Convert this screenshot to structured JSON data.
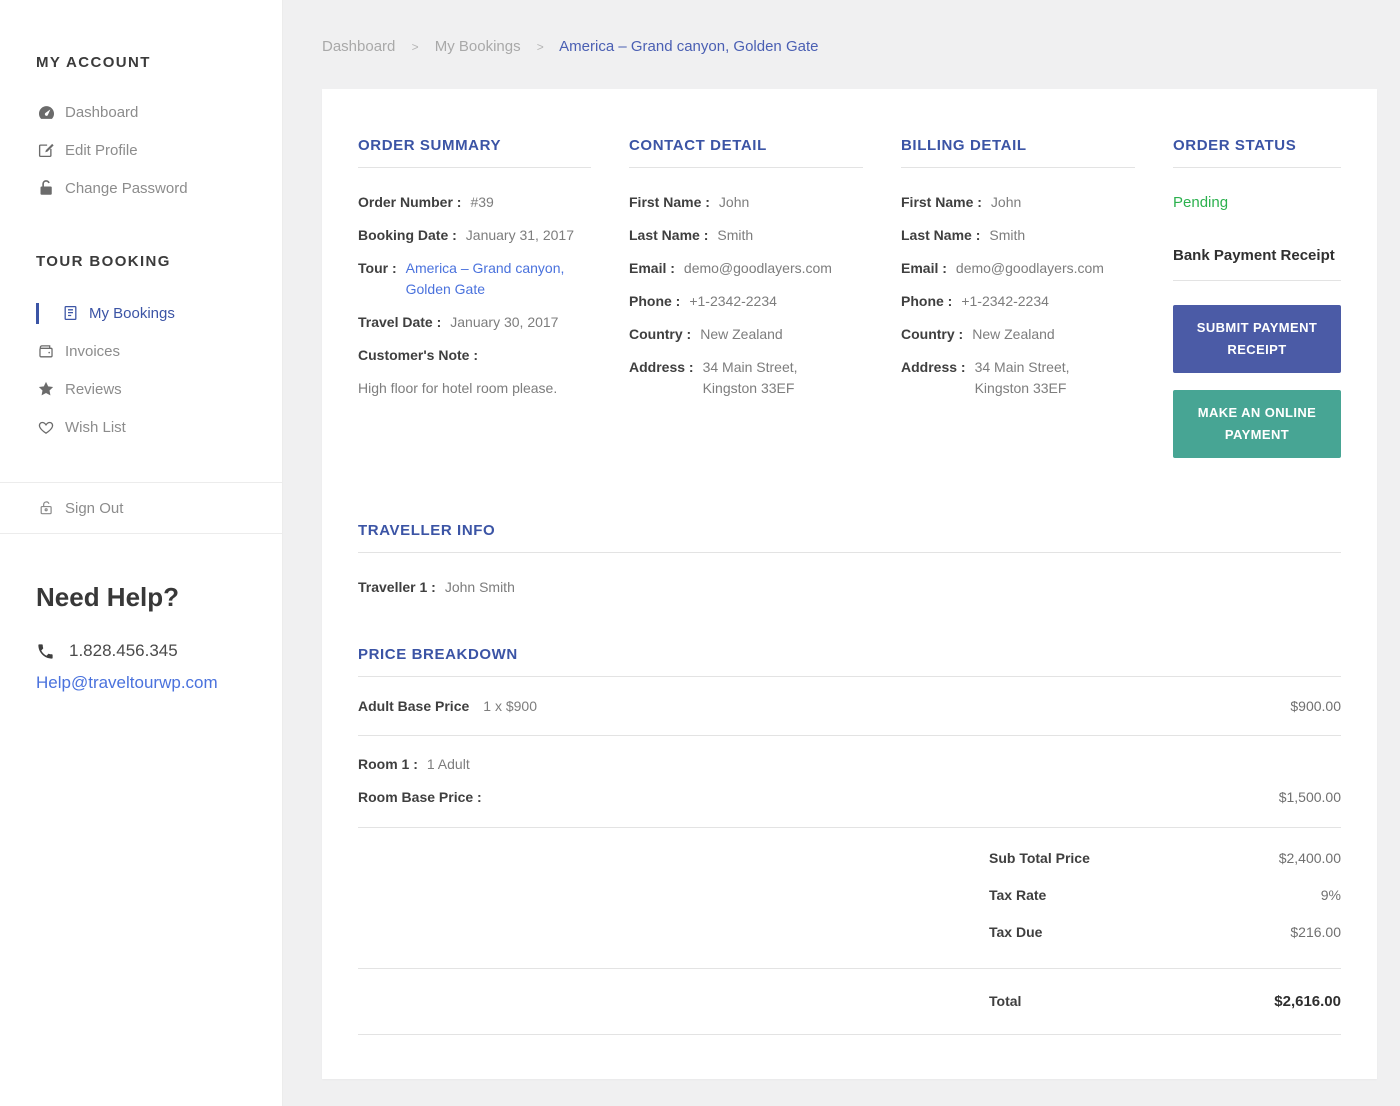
{
  "colors": {
    "accent": "#3b54a5",
    "link_blue": "#4a72dd",
    "status_green": "#2cb14e",
    "button_indigo": "#4b5ba6",
    "button_teal": "#47a594",
    "page_bg": "#f0f0f1"
  },
  "breadcrumb": {
    "home": "Dashboard",
    "section": "My Bookings",
    "current": "America – Grand canyon, Golden Gate",
    "separator": ">"
  },
  "sidebar": {
    "account_title": "MY ACCOUNT",
    "account_items": [
      {
        "label": "Dashboard",
        "icon": "dashboard-icon"
      },
      {
        "label": "Edit Profile",
        "icon": "edit-icon"
      },
      {
        "label": "Change Password",
        "icon": "lock-icon"
      }
    ],
    "booking_title": "TOUR BOOKING",
    "booking_items": [
      {
        "label": "My Bookings",
        "icon": "document-icon",
        "active": true
      },
      {
        "label": "Invoices",
        "icon": "wallet-icon"
      },
      {
        "label": "Reviews",
        "icon": "star-icon"
      },
      {
        "label": "Wish List",
        "icon": "heart-icon"
      }
    ],
    "sign_out": {
      "label": "Sign Out",
      "icon": "unlock-icon"
    },
    "help_title": "Need Help?",
    "help_phone": "1.828.456.345",
    "help_email": "Help@traveltourwp.com"
  },
  "order_summary": {
    "title": "ORDER SUMMARY",
    "order_number_label": "Order Number :",
    "order_number": "#39",
    "booking_date_label": "Booking Date :",
    "booking_date": "January 31, 2017",
    "tour_label": "Tour :",
    "tour_line1": "America – Grand canyon,",
    "tour_line2": "Golden Gate",
    "travel_date_label": "Travel Date :",
    "travel_date": "January 30, 2017",
    "note_label": "Customer's Note :",
    "note": "High floor for hotel room please."
  },
  "contact": {
    "title": "CONTACT DETAIL",
    "rows": [
      {
        "label": "First Name :",
        "value": "John"
      },
      {
        "label": "Last Name :",
        "value": "Smith"
      },
      {
        "label": "Email :",
        "value": "demo@goodlayers.com"
      },
      {
        "label": "Phone :",
        "value": "+1-2342-2234"
      },
      {
        "label": "Country :",
        "value": "New Zealand"
      },
      {
        "label": "Address :",
        "value": "34 Main Street,",
        "value2": "Kingston 33EF"
      }
    ]
  },
  "billing": {
    "title": "BILLING DETAIL",
    "rows": [
      {
        "label": "First Name :",
        "value": "John"
      },
      {
        "label": "Last Name :",
        "value": "Smith"
      },
      {
        "label": "Email :",
        "value": "demo@goodlayers.com"
      },
      {
        "label": "Phone :",
        "value": "+1-2342-2234"
      },
      {
        "label": "Country :",
        "value": "New Zealand"
      },
      {
        "label": "Address :",
        "value": "34 Main Street,",
        "value2": "Kingston 33EF"
      }
    ]
  },
  "order_status": {
    "title": "ORDER STATUS",
    "status": "Pending",
    "receipt_label": "Bank Payment Receipt",
    "submit_button": "SUBMIT PAYMENT RECEIPT",
    "pay_button": "MAKE AN ONLINE PAYMENT"
  },
  "traveller": {
    "title": "TRAVELLER INFO",
    "rows": [
      {
        "label": "Traveller 1 :",
        "value": "John Smith"
      }
    ]
  },
  "price": {
    "title": "PRICE BREAKDOWN",
    "items": [
      {
        "label": "Adult Base Price",
        "qty": "1 x $900",
        "amount": "$900.00"
      }
    ],
    "room_label": "Room 1 :",
    "room_value": "1 Adult",
    "room_price_label": "Room Base Price :",
    "room_price": "$1,500.00",
    "subtotal_label": "Sub Total Price",
    "subtotal": "$2,400.00",
    "tax_rate_label": "Tax Rate",
    "tax_rate": "9%",
    "tax_due_label": "Tax Due",
    "tax_due": "$216.00",
    "total_label": "Total",
    "total": "$2,616.00"
  }
}
